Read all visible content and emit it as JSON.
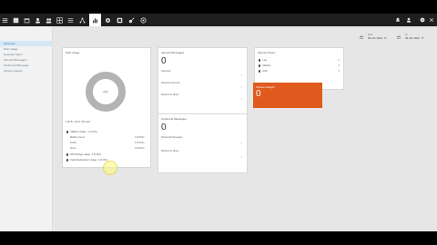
{
  "toolbar": {
    "icons": [
      "menu-icon",
      "home-icon",
      "calendar-icon",
      "user-icon",
      "users-icon",
      "grid-icon",
      "list-icon",
      "network-icon",
      "chart-icon",
      "gear-icon",
      "wrench-icon",
      "key-icon",
      "plugin-icon"
    ],
    "active": "chart-icon"
  },
  "sidebar": {
    "items": [
      {
        "label": "Overview",
        "active": true
      },
      {
        "label": "Disk Usage",
        "active": false
      },
      {
        "label": "Detected Spam",
        "active": false
      },
      {
        "label": "Inbound Messages",
        "active": false
      },
      {
        "label": "Outbound Messages",
        "active": false
      },
      {
        "label": "Viruses Caught",
        "active": false
      }
    ]
  },
  "date_from": {
    "label": "From",
    "value": "09 / 23 / 2021 · ☰"
  },
  "date_to": {
    "label": "To",
    "value": "09 / 30 / 2021 · ☰"
  },
  "disk_usage": {
    "title": "Disk Usage",
    "donut_center": "0%",
    "used_total": "0.00 B / 100.0 GB used",
    "mailbox_usage": "Mailbox Usage",
    "mailbox_usage_val": "0 (0.00%)",
    "sub_items": [
      {
        "label": "Mailbox Items",
        "value": "0 (0.00%)"
      },
      {
        "label": "Drafts",
        "value": "0 (0.00%)"
      },
      {
        "label": "Items",
        "value": "0 (0.00%)"
      }
    ],
    "dm_storage": "DM Storage usage",
    "dm_storage_val": "0 (0.00%)",
    "fatal_redemption": "Fatal Redemption Usage",
    "fatal_redemption_val": "0 (0.00%)"
  },
  "inbound": {
    "title": "Inbound Messages",
    "count": "0",
    "rows": [
      "Scanned",
      "Rejected Inbound",
      "Marked as Spam"
    ]
  },
  "outbound": {
    "title": "Outbound Messages",
    "count": "0",
    "rows": [
      "Delivered Messages",
      "Marked as Spam"
    ]
  },
  "inbound_stats": {
    "title": "Inbound Spam",
    "rows": [
      {
        "label": "Low",
        "value": "0"
      },
      {
        "label": "Medium",
        "value": "0"
      },
      {
        "label": "High",
        "value": "0"
      }
    ]
  },
  "viruses": {
    "title": "Viruses Caught",
    "count": "0"
  },
  "colors": {
    "accent": "#e05a1e",
    "donut": "#b3b3b3",
    "sidebar_active": "#d6e8f5"
  }
}
